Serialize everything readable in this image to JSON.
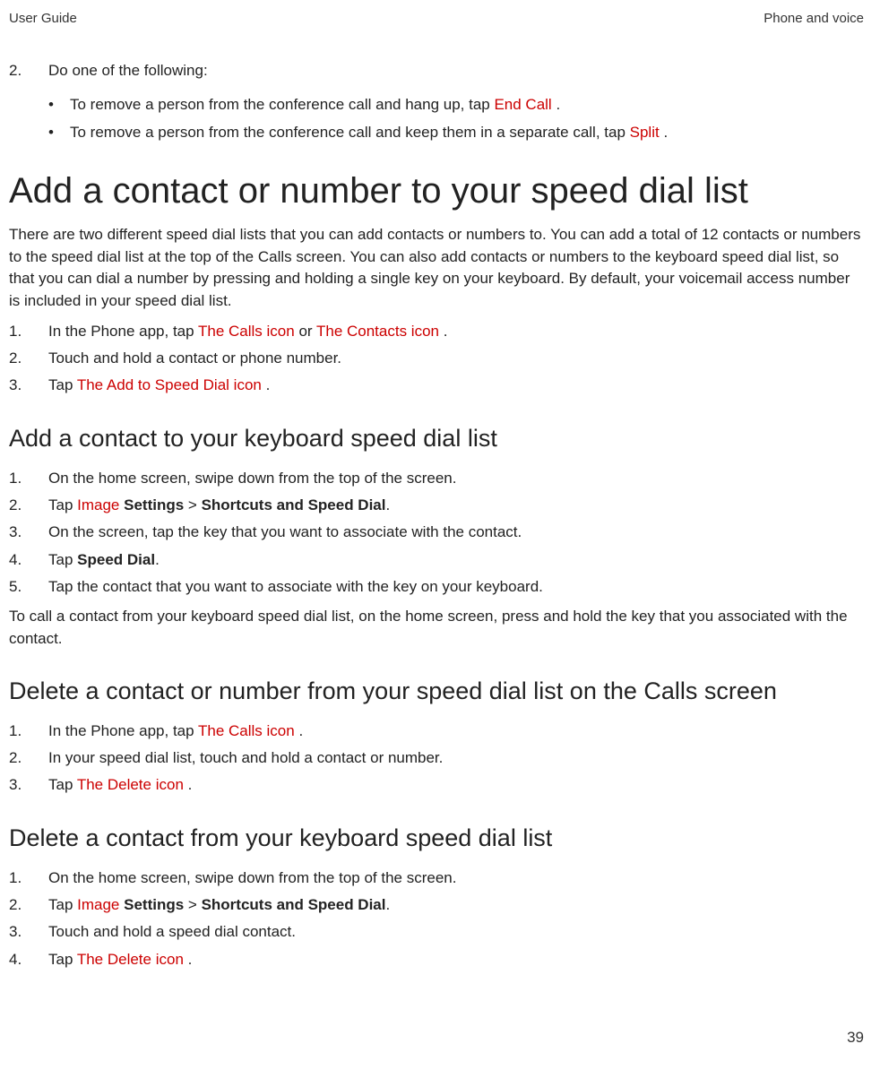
{
  "header": {
    "left": "User Guide",
    "right": "Phone and voice"
  },
  "page_number": "39",
  "intro": {
    "num": "2.",
    "lead": "Do one of the following:",
    "bullets": [
      {
        "pre": "To remove a person from the conference call and hang up, tap  ",
        "link": "End Call",
        "post": " ."
      },
      {
        "pre": "To remove a person from the conference call and keep them in a separate call, tap  ",
        "link": "Split",
        "post": " ."
      }
    ]
  },
  "sec1": {
    "heading": "Add a contact or number to your speed dial list",
    "para": "There are two different speed dial lists that you can add contacts or numbers to. You can add a total of 12 contacts or numbers to the speed dial list at the top of the Calls screen. You can also add contacts or numbers to the keyboard speed dial list, so that you can dial a number by pressing and holding a single key on your keyboard. By default, your voicemail access number is included in your speed dial list.",
    "steps": [
      {
        "num": "1.",
        "pre": "In the Phone app, tap  ",
        "link1": "The Calls icon",
        "mid": "  or  ",
        "link2": "The Contacts icon",
        "post": " ."
      },
      {
        "num": "2.",
        "text": "Touch and hold a contact or phone number."
      },
      {
        "num": "3.",
        "pre": "Tap  ",
        "link1": "The Add to Speed Dial icon",
        "post": " ."
      }
    ]
  },
  "sec2": {
    "heading": "Add a contact to your keyboard speed dial list",
    "steps": [
      {
        "num": "1.",
        "text": "On the home screen, swipe down from the top of the screen."
      },
      {
        "num": "2.",
        "pre": "Tap  ",
        "link1": "Image",
        "mid": "  ",
        "bold1": "Settings",
        "gt": " > ",
        "bold2": "Shortcuts and Speed Dial",
        "post": "."
      },
      {
        "num": "3.",
        "text": "On the screen, tap the key that you want to associate with the contact."
      },
      {
        "num": "4.",
        "pre": "Tap ",
        "bold1": "Speed Dial",
        "post": "."
      },
      {
        "num": "5.",
        "text": "Tap the contact that you want to associate with the key on your keyboard."
      }
    ],
    "tail": "To call a contact from your keyboard speed dial list, on the home screen, press and hold the key that you associated with the contact."
  },
  "sec3": {
    "heading": "Delete a contact or number from your speed dial list on the Calls screen",
    "steps": [
      {
        "num": "1.",
        "pre": "In the Phone app, tap  ",
        "link1": "The Calls icon",
        "post": " ."
      },
      {
        "num": "2.",
        "text": "In your speed dial list, touch and hold a contact or number."
      },
      {
        "num": "3.",
        "pre": "Tap  ",
        "link1": "The Delete icon",
        "post": " ."
      }
    ]
  },
  "sec4": {
    "heading": "Delete a contact from your keyboard speed dial list",
    "steps": [
      {
        "num": "1.",
        "text": "On the home screen, swipe down from the top of the screen."
      },
      {
        "num": "2.",
        "pre": "Tap  ",
        "link1": "Image",
        "mid": "  ",
        "bold1": "Settings",
        "gt": " > ",
        "bold2": "Shortcuts and Speed Dial",
        "post": "."
      },
      {
        "num": "3.",
        "text": "Touch and hold a speed dial contact."
      },
      {
        "num": "4.",
        "pre": "Tap ",
        "link1": "The Delete icon",
        "post": " ."
      }
    ]
  }
}
